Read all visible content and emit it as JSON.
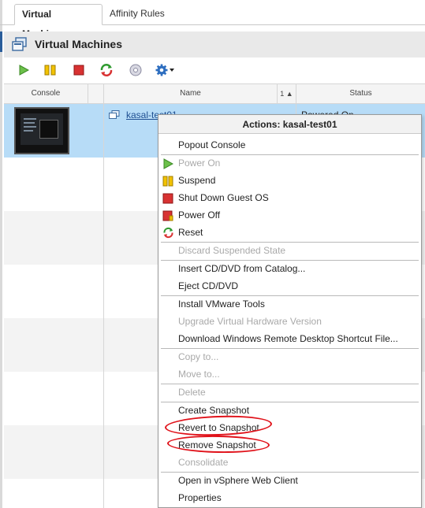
{
  "tabs": [
    {
      "label": "Virtual Machines"
    },
    {
      "label": "Affinity Rules"
    }
  ],
  "panel": {
    "title": "Virtual Machines",
    "icon": "virtual-machines-icon"
  },
  "toolbar": {
    "buttons": [
      "power-on-icon",
      "suspend-icon",
      "power-off-icon",
      "reset-icon",
      "media-icon",
      "gear-icon"
    ]
  },
  "grid": {
    "columns": [
      {
        "label": "Console"
      },
      {
        "label": "Name",
        "sort": "1 ▲"
      },
      {
        "label": "Status"
      }
    ],
    "rows": [
      {
        "name": "kasal-test01",
        "status": "Powered On"
      }
    ]
  },
  "menu": {
    "title": "Actions: kasal-test01",
    "items": [
      {
        "label": "Popout Console",
        "enabled": true
      },
      {
        "label": "Power On",
        "enabled": false,
        "icon": "power-on-icon"
      },
      {
        "label": "Suspend",
        "enabled": true,
        "icon": "suspend-icon"
      },
      {
        "label": "Shut Down Guest OS",
        "enabled": true,
        "icon": "shutdown-icon"
      },
      {
        "label": "Power Off",
        "enabled": true,
        "icon": "power-off-icon"
      },
      {
        "label": "Reset",
        "enabled": true,
        "icon": "reset-icon"
      },
      {
        "label": "Discard Suspended State",
        "enabled": false
      },
      {
        "label": "Insert CD/DVD from Catalog...",
        "enabled": true
      },
      {
        "label": "Eject CD/DVD",
        "enabled": true
      },
      {
        "label": "Install VMware Tools",
        "enabled": true
      },
      {
        "label": "Upgrade Virtual Hardware Version",
        "enabled": false
      },
      {
        "label": "Download Windows Remote Desktop Shortcut File...",
        "enabled": true
      },
      {
        "label": "Copy to...",
        "enabled": false
      },
      {
        "label": "Move to...",
        "enabled": false
      },
      {
        "label": "Delete",
        "enabled": false
      },
      {
        "label": "Create Snapshot",
        "enabled": true
      },
      {
        "label": "Revert to Snapshot",
        "enabled": true
      },
      {
        "label": "Remove Snapshot",
        "enabled": true
      },
      {
        "label": "Consolidate",
        "enabled": false
      },
      {
        "label": "Open in vSphere Web Client",
        "enabled": true
      },
      {
        "label": "Properties",
        "enabled": true
      }
    ]
  },
  "colors": {
    "selection": "#b7dcf7",
    "link": "#1f4f92",
    "annotation": "#e0121a"
  }
}
